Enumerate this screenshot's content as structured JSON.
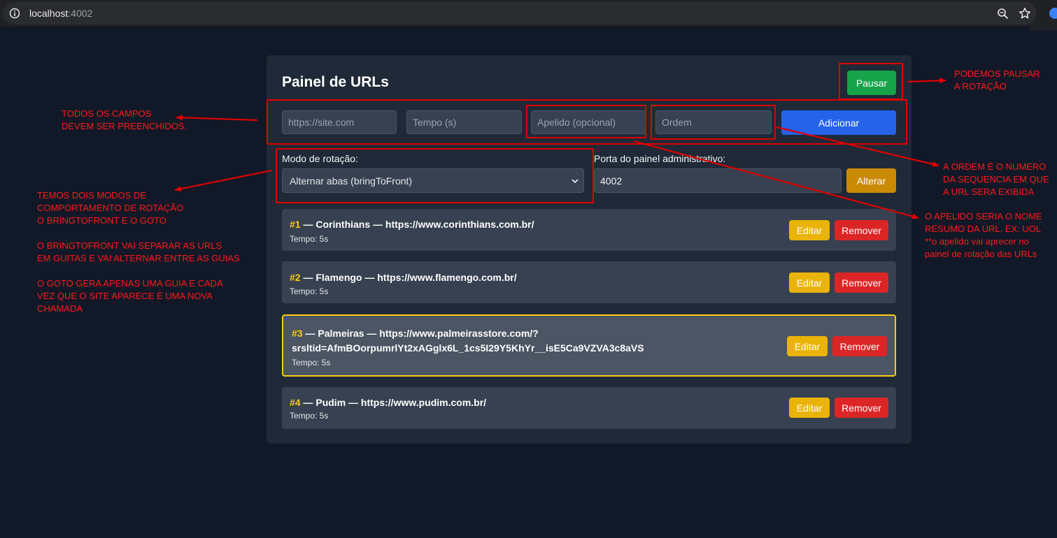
{
  "browser": {
    "host": "localhost",
    "port": ":4002",
    "icons": [
      "info-icon",
      "zoom-icon",
      "star-icon"
    ]
  },
  "panel": {
    "title": "Painel de URLs",
    "pause_label": "Pausar",
    "form": {
      "url_placeholder": "https://site.com",
      "time_placeholder": "Tempo (s)",
      "nickname_placeholder": "Apelido (opcional)",
      "order_placeholder": "Ordem",
      "add_label": "Adicionar"
    },
    "rotation_mode": {
      "label": "Modo de rotação:",
      "selected": "Alternar abas (bringToFront)"
    },
    "admin_port": {
      "label": "Porta do painel administrativo:",
      "value": "4002",
      "change_label": "Alterar"
    },
    "items": [
      {
        "num": "#1",
        "text": " — Corinthians — https://www.corinthians.com.br/",
        "time": "Tempo: 5s",
        "edit": "Editar",
        "remove": "Remover"
      },
      {
        "num": "#2",
        "text": " — Flamengo — https://www.flamengo.com.br/",
        "time": "Tempo: 5s",
        "edit": "Editar",
        "remove": "Remover"
      },
      {
        "num": "#3",
        "text": " — Palmeiras — https://www.palmeirasstore.com/?",
        "text2": "srsltid=AfmBOorpumrlYt2xAGglx6L_1cs5I29Y5KhYr__isE5Ca9VZVA3c8aVS",
        "time": "Tempo: 5s",
        "edit": "Editar",
        "remove": "Remover"
      },
      {
        "num": "#4",
        "text": " — Pudim — https://www.pudim.com.br/",
        "time": "Tempo: 5s",
        "edit": "Editar",
        "remove": "Remover"
      }
    ]
  },
  "annotations": {
    "fields": [
      "TODOS OS CAMPOS",
      "DEVEM SER PREENCHIDOS."
    ],
    "modes": [
      "TEMOS DOIS MODOS DE",
      "COMPORTAMENTO DE ROTAÇÃO",
      "O BRINGTOFRONT E O GOTO",
      "",
      "O BRINGTOFRONT VAI SEPARAR AS URLS",
      "EM GUITAS E VAI ALTERNAR ENTRE AS GUIAS",
      "",
      "O GOTO GERA APENAS UMA GUIA E CADA",
      "VEZ QUE O SITE APARECE É UMA NOVA",
      "CHAMADA"
    ],
    "pause": [
      "PODEMOS PAUSAR",
      "A ROTAÇÃO"
    ],
    "order": [
      "A ORDEM É O NUMERO",
      "DA SEQUENCIA EM QUE",
      "A URL SERA EXIBIDA"
    ],
    "nickname": [
      "O APELIDO SERIA O NOME",
      "RESUMO DA URL. EX: UOL",
      "**o apelido vai aprecer no",
      "painel de rotação das URLs"
    ]
  },
  "colors": {
    "background": "#111827",
    "panel": "#1f2937",
    "accent_blue": "#2563eb",
    "pause_green": "#16a34a",
    "active_border": "#facc15",
    "annotation_red": "#ff1a1a"
  }
}
